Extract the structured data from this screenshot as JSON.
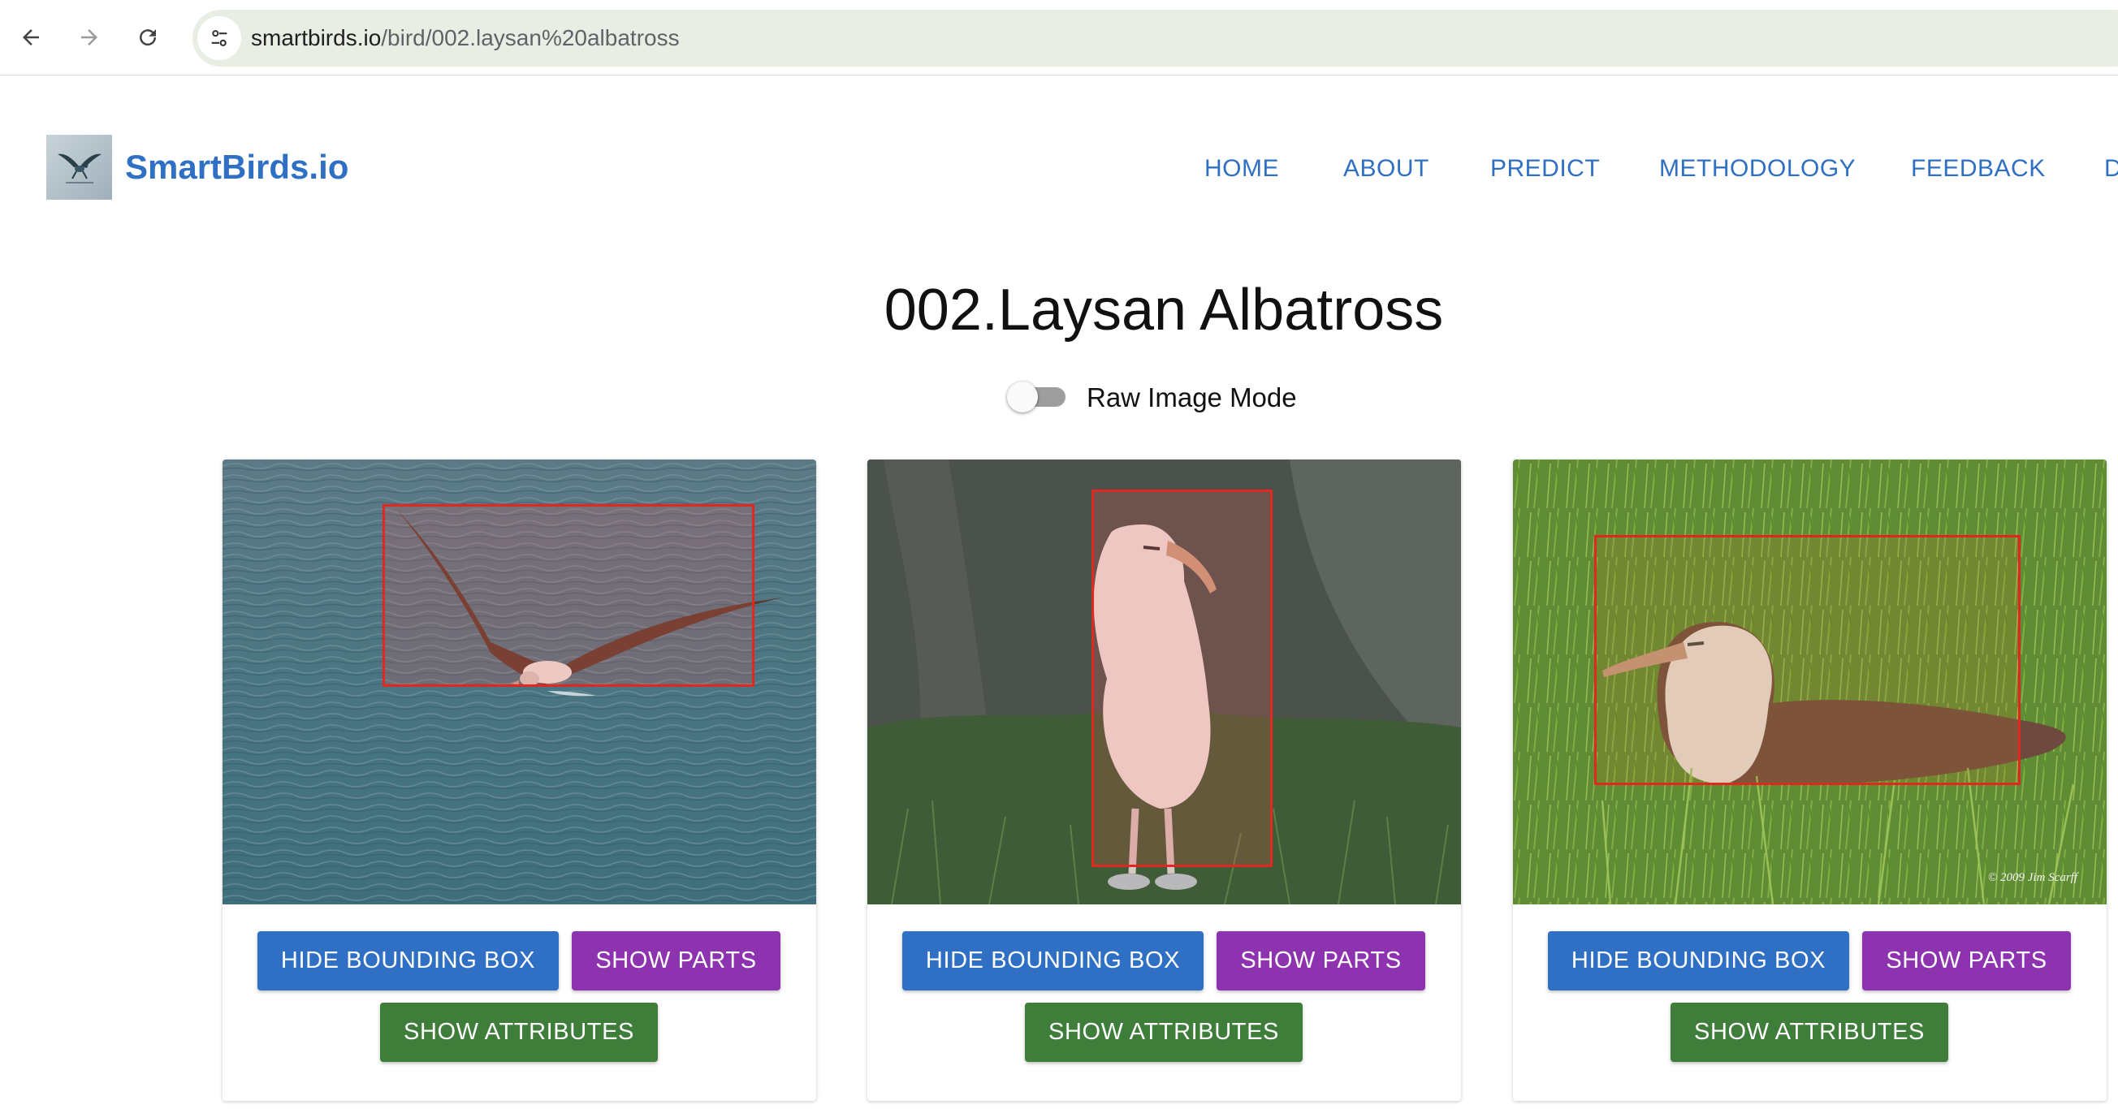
{
  "browser": {
    "url_host": "smartbirds.io",
    "url_path": "/bird/002.laysan%20albatross",
    "back_icon": "arrow-left-icon",
    "forward_icon": "arrow-right-icon",
    "reload_icon": "reload-icon",
    "site_info_icon": "tune-icon"
  },
  "header": {
    "brand": "SmartBirds.io",
    "logo_icon": "bird-logo-icon",
    "nav": [
      {
        "label": "HOME"
      },
      {
        "label": "ABOUT"
      },
      {
        "label": "PREDICT"
      },
      {
        "label": "METHODOLOGY"
      },
      {
        "label": "FEEDBACK"
      },
      {
        "label": "D"
      }
    ]
  },
  "main": {
    "title": "002.Laysan Albatross",
    "raw_mode": {
      "label": "Raw Image Mode",
      "checked": false
    }
  },
  "cards": [
    {
      "photo": "albatross-flying-over-water",
      "watermark": "",
      "bbox_btn": "HIDE BOUNDING BOX",
      "parts_btn": "SHOW PARTS",
      "attrs_btn": "SHOW ATTRIBUTES"
    },
    {
      "photo": "albatross-standing-by-tree",
      "watermark": "",
      "bbox_btn": "HIDE BOUNDING BOX",
      "parts_btn": "SHOW PARTS",
      "attrs_btn": "SHOW ATTRIBUTES"
    },
    {
      "photo": "albatross-sitting-in-grass",
      "watermark": "© 2009 Jim Scarff",
      "bbox_btn": "HIDE BOUNDING BOX",
      "parts_btn": "SHOW PARTS",
      "attrs_btn": "SHOW ATTRIBUTES"
    }
  ],
  "colors": {
    "brand_blue": "#2f6fc4",
    "parts_purple": "#8e33b0",
    "attrs_green": "#3f7d3a",
    "bbox_red": "#e0281e"
  }
}
